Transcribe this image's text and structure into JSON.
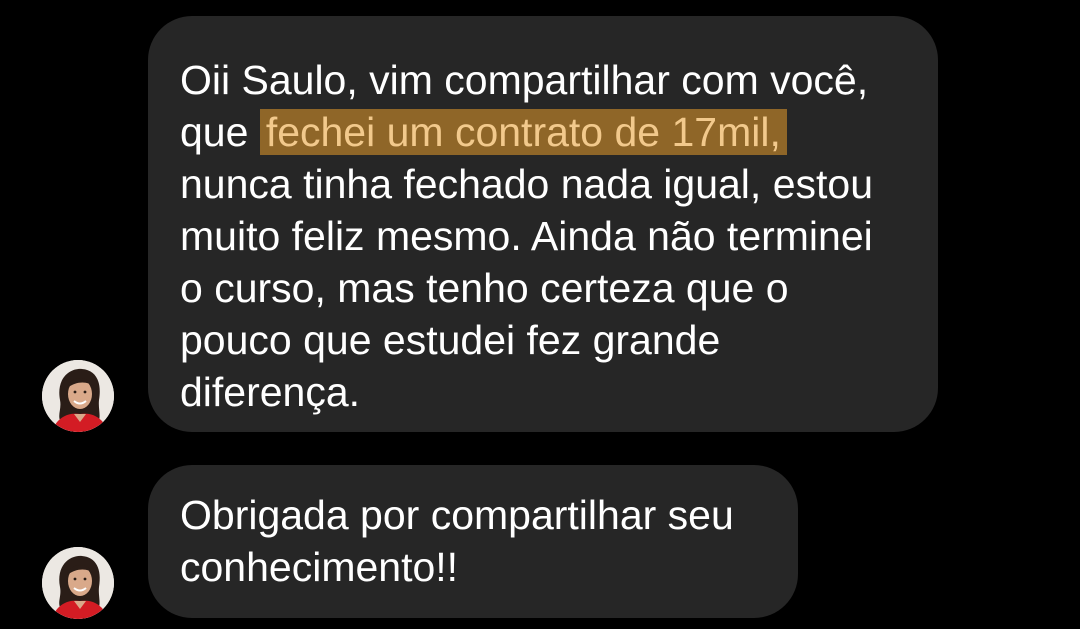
{
  "colors": {
    "background": "#000000",
    "bubble": "#262626",
    "text": "#ffffff",
    "highlight_bg": "#8f6628",
    "highlight_text": "#f2c98c"
  },
  "messages": [
    {
      "avatar": "user-avatar-icon",
      "lines": [
        {
          "text": "Oii Saulo, vim compartilhar com você,"
        },
        {
          "before": "que ",
          "highlight": "fechei um contrato de 17mil,"
        },
        {
          "text": "nunca tinha fechado nada igual, estou"
        },
        {
          "text": "muito feliz mesmo. Ainda não terminei"
        },
        {
          "text": "o curso, mas tenho certeza que o"
        },
        {
          "text": "pouco que estudei fez grande"
        },
        {
          "text": "diferença."
        }
      ]
    },
    {
      "avatar": "user-avatar-icon",
      "lines": [
        {
          "text": "Obrigada por compartilhar seu"
        },
        {
          "text": "conhecimento!!"
        }
      ]
    }
  ]
}
